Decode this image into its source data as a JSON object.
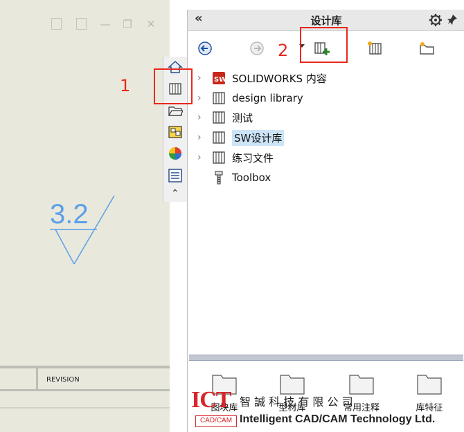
{
  "window_controls": [
    "◂",
    "▸",
    "—",
    "❐",
    "✕"
  ],
  "drawing": {
    "surface_finish_value": "3.2",
    "revision_label": "REVISION"
  },
  "panel": {
    "title": "设计库",
    "collapse_glyph": "«"
  },
  "tree": [
    {
      "label": "SOLIDWORKS 内容",
      "icon": "solidworks-content-icon",
      "expandable": true,
      "selected": false
    },
    {
      "label": "design library",
      "icon": "library-books-icon",
      "expandable": true,
      "selected": false
    },
    {
      "label": "测试",
      "icon": "library-books-icon",
      "expandable": true,
      "selected": false
    },
    {
      "label": "SW设计库",
      "icon": "library-books-icon",
      "expandable": true,
      "selected": true
    },
    {
      "label": "练习文件",
      "icon": "library-books-icon",
      "expandable": true,
      "selected": false
    },
    {
      "label": "Toolbox",
      "icon": "toolbox-screw-icon",
      "expandable": false,
      "selected": false
    }
  ],
  "thumbnails": [
    "图块库",
    "型材库",
    "常用注释",
    "库特征"
  ],
  "annotations": {
    "one": "1",
    "two": "2"
  },
  "watermark": {
    "logo_ict": "ICT",
    "logo_sub": "CAD/CAM",
    "company_cn": "智 誠 科 技 有 限 公 司",
    "company_en": "Intelligent CAD/CAM Technology Ltd."
  },
  "colors": {
    "accent_red": "#e8281c",
    "selection": "#cce4f7",
    "drawing_bg": "#e9e8dd",
    "dimension_blue": "#5aa0e8"
  }
}
